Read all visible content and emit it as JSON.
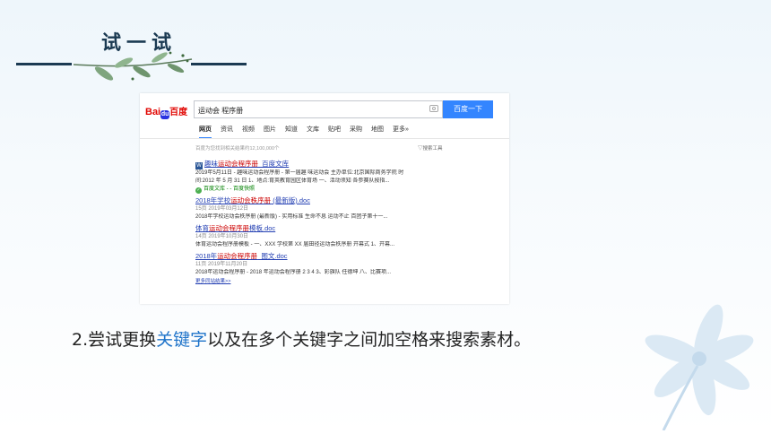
{
  "slide": {
    "title": "试一试",
    "caption_prefix": "2.尝试更换",
    "caption_keyword": "关键字",
    "caption_suffix": "以及在多个关键字之间加空格来搜索素材。"
  },
  "browser": {
    "logo_left": "Bai",
    "logo_paw": "du",
    "logo_right": "百度",
    "search_value": "运动会 程序册",
    "search_button": "百度一下",
    "tabs": [
      "网页",
      "资讯",
      "视频",
      "图片",
      "知道",
      "文库",
      "贴吧",
      "采购",
      "地图",
      "更多»"
    ],
    "active_tab": "网页",
    "result_count": "百度为您找到相关结果约12,100,000个",
    "search_tools": "▽搜索工具",
    "results": [
      {
        "title_pre": "趣味",
        "title_hl": "运动会程序册",
        "title_post": "_百度文库",
        "line1": "2019年5月11日 - 趣味运动会程序册 - 第一届趣 味运动会 主办单位:北京国际商务学院 时",
        "line2": "间:2012 年 5 月 31 日 1、地点:育英教育园区体育场 一、活动须知 各参赛队按指...",
        "source": "百度文库 - - 百度快照"
      },
      {
        "title_pre": "2018年学校",
        "title_hl": "运动会秩序册",
        "title_post": " (最新版).doc",
        "meta": "15页  2019年03月12日",
        "line1": "2018年学校运动会秩序册 (最新版) - 实用标准 生命不息 运动不止 百团子第十一..."
      },
      {
        "title_pre": "体育",
        "title_hl": "运动会程序册",
        "title_post": "模板.doc",
        "meta": "14页  2019年10月30日",
        "line1": "体育运动会程序册模板 - 一、XXX 学校第 XX 届田径运动会秩序册 开幕式 1、开幕..."
      },
      {
        "title_pre": "2018年",
        "title_hl": "运动会程序册",
        "title_post": "_图文.doc",
        "meta": "11页  2019年11月20日",
        "line1": "2018年运动会程序册 - 2018 年运动会程序册 2 3 4 3、彩旗队 任德坤 八、比赛项..."
      }
    ],
    "more_results": "更多同站结果>>"
  }
}
